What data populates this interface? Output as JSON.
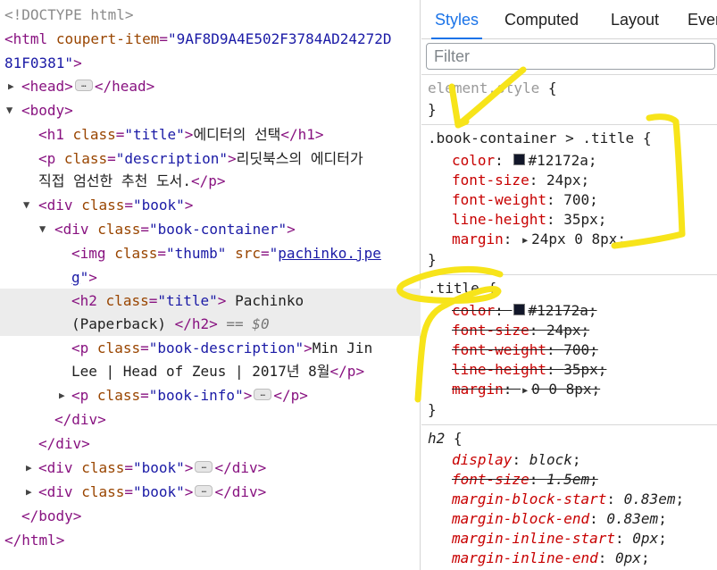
{
  "elements": {
    "doctype": "<!DOCTYPE html>",
    "html_tag": "html",
    "html_attr_name": "coupert-item",
    "html_attr_value_1": "\"9AF8D9A4E502F3784AD24272D",
    "html_attr_value_2": "81F0381\"",
    "head_tag": "head",
    "body_tag": "body",
    "h1_class": "\"title\"",
    "h1_text": "에디터의 선택",
    "p_class": "\"description\"",
    "p_text_1": "리딧북스의 에디터가",
    "p_text_2": "직접 엄선한 추천 도서.",
    "div_book_class": "\"book\"",
    "div_container_class": "\"book-container\"",
    "img_class": "\"thumb\"",
    "img_src_1": "pachinko.jpe",
    "img_src_2": "g",
    "h2_class": "\"title\"",
    "h2_text_1": " Pachinko",
    "h2_text_2": "(Paperback) ",
    "selected_marker": "== $0",
    "p_bookdesc_class": "\"book-description\"",
    "p_bookdesc_text_1": "Min Jin",
    "p_bookdesc_text_2": "Lee | Head of Zeus | 2017년 8월",
    "p_bookinfo_class": "\"book-info\"",
    "ellipsis": "…",
    "div_tag": "div",
    "p_tag": "p",
    "img_tag": "img",
    "h1_tag": "h1",
    "h2_tag": "h2",
    "class_attr": "class",
    "src_attr": "src"
  },
  "styles_panel": {
    "tabs": [
      "Styles",
      "Computed",
      "Layout",
      "Even"
    ],
    "active_tab": "Styles",
    "filter_placeholder": "Filter",
    "element_style": "element.style",
    "rule1": {
      "selector": ".book-container > .title",
      "props": [
        {
          "name": "color",
          "value": "#12172a",
          "swatch": "#12172a"
        },
        {
          "name": "font-size",
          "value": "24px"
        },
        {
          "name": "font-weight",
          "value": "700"
        },
        {
          "name": "line-height",
          "value": "35px"
        },
        {
          "name": "margin",
          "value": "24px 0 8px"
        }
      ]
    },
    "rule2": {
      "selector": ".title",
      "props": [
        {
          "name": "color",
          "value": "#12172a",
          "swatch": "#12172a"
        },
        {
          "name": "font-size",
          "value": "24px"
        },
        {
          "name": "font-weight",
          "value": "700"
        },
        {
          "name": "line-height",
          "value": "35px"
        },
        {
          "name": "margin",
          "value": "0 0 8px"
        }
      ]
    },
    "rule3": {
      "selector": "h2",
      "props": [
        {
          "name": "display",
          "value": "block"
        },
        {
          "name": "font-size",
          "value": "1.5em"
        },
        {
          "name": "margin-block-start",
          "value": "0.83em"
        },
        {
          "name": "margin-block-end",
          "value": "0.83em"
        },
        {
          "name": "margin-inline-start",
          "value": "0px"
        },
        {
          "name": "margin-inline-end",
          "value": "0px"
        }
      ]
    }
  },
  "colors": {
    "annotation": "#f7e41a",
    "accent": "#1a73e8",
    "swatch": "#12172a"
  }
}
